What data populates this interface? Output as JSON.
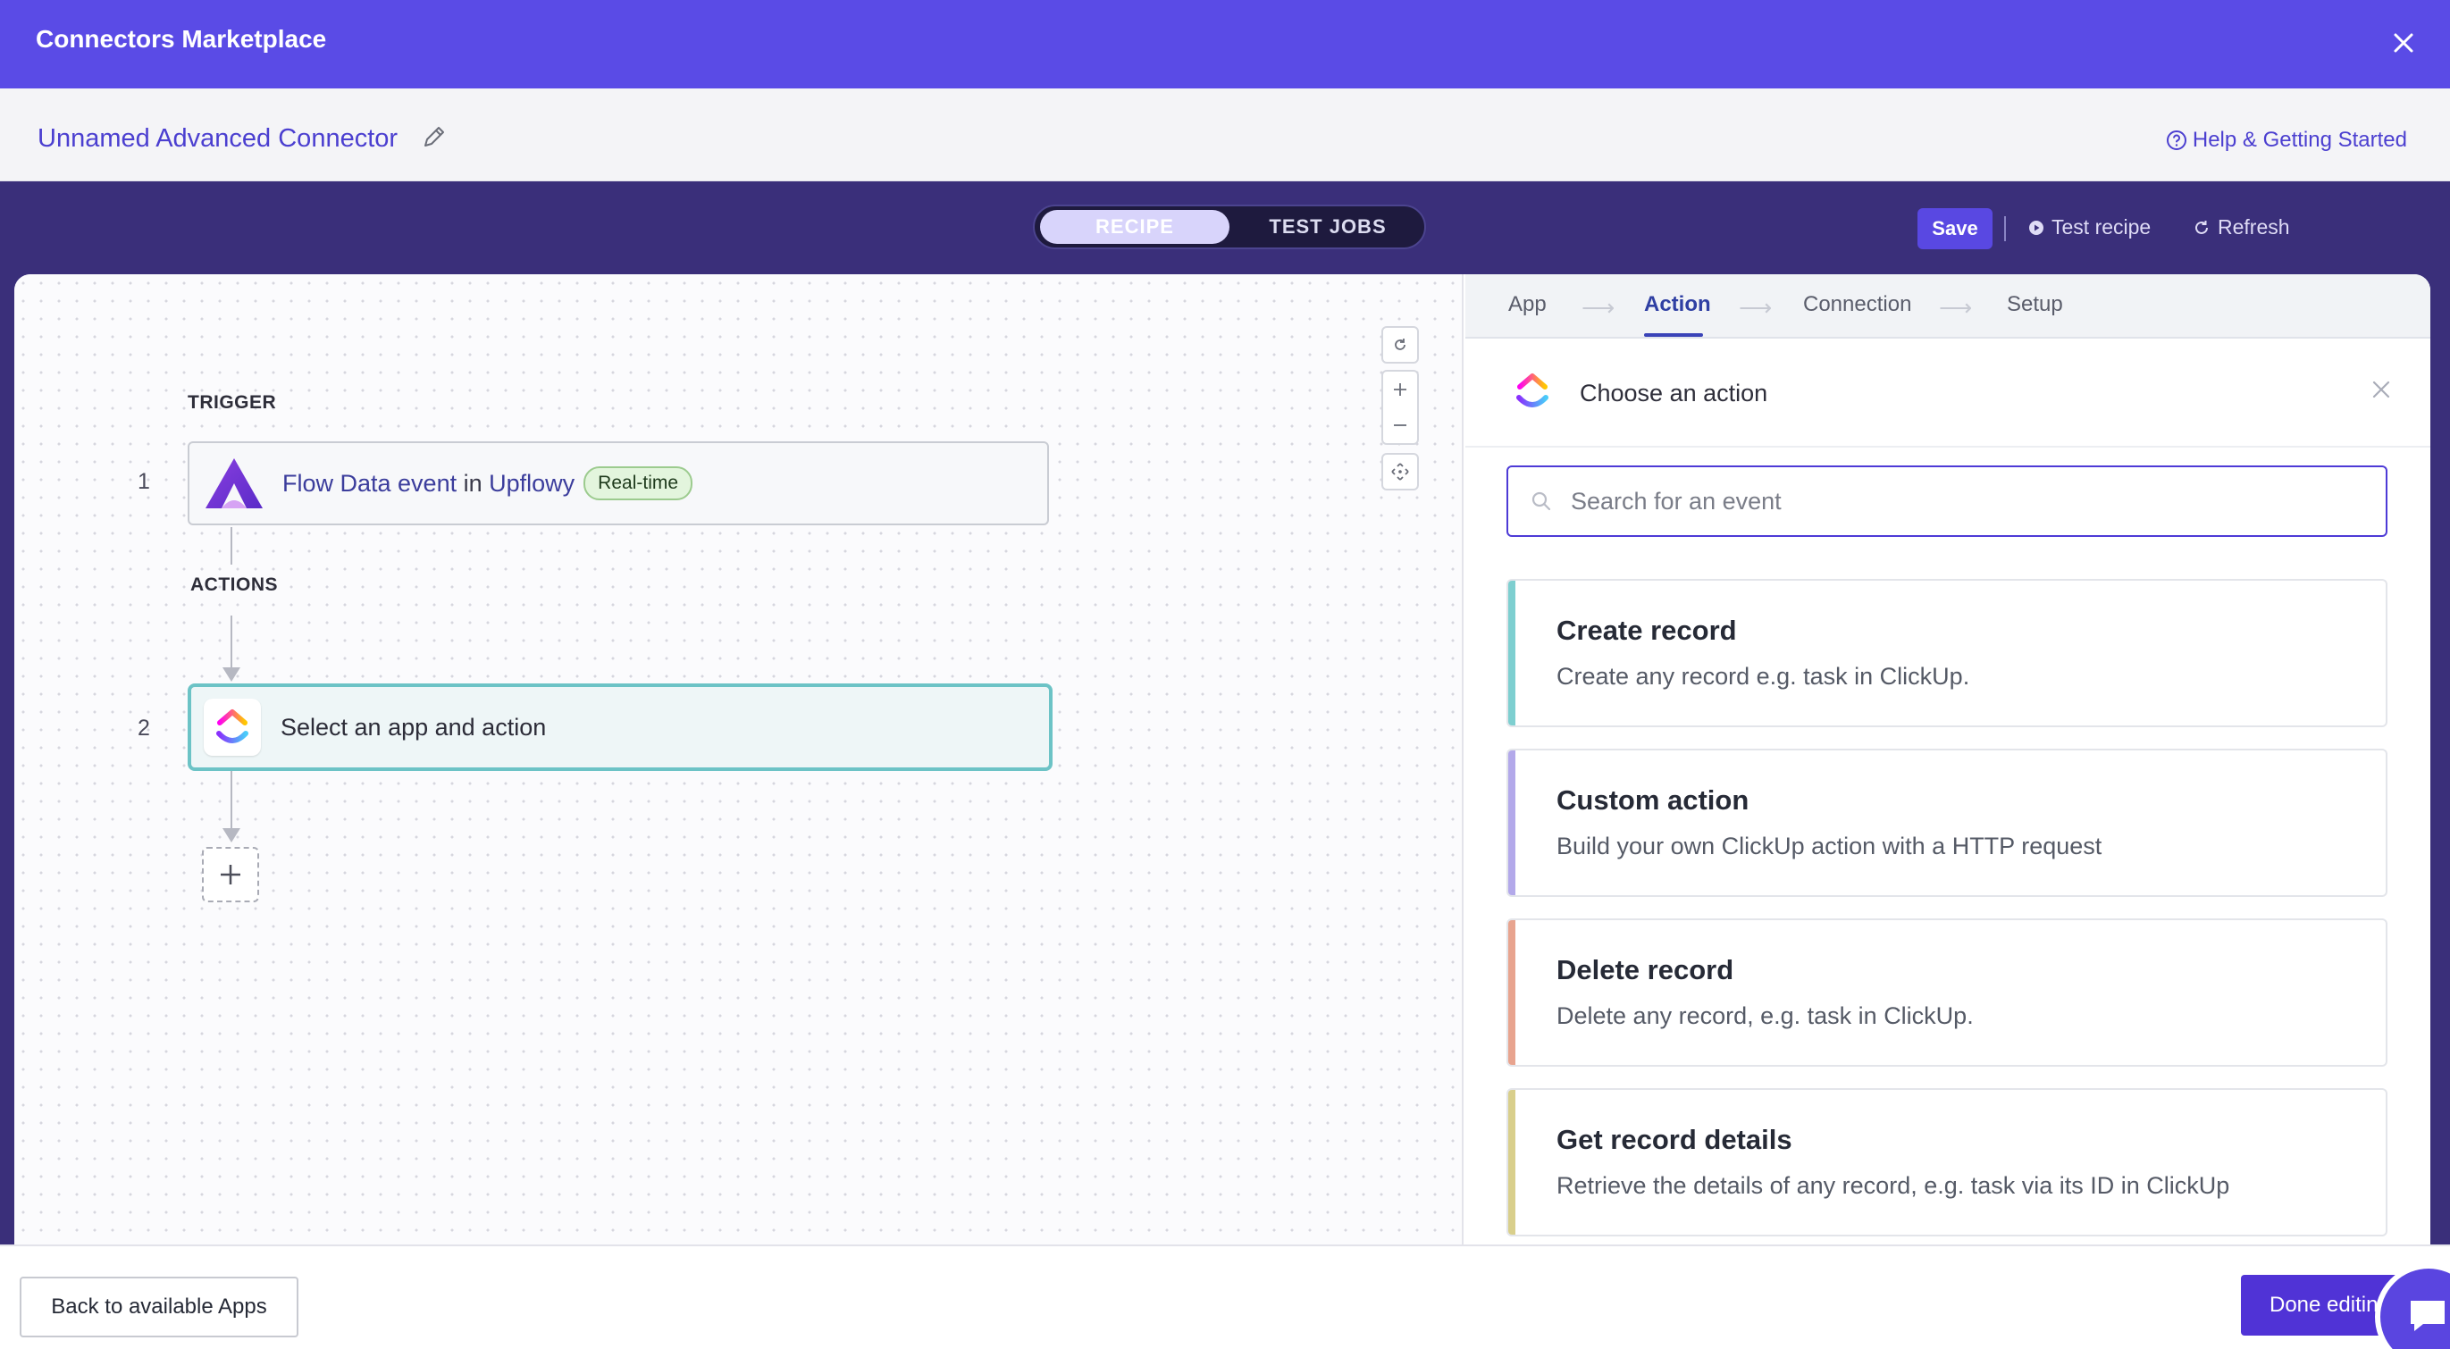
{
  "modal": {
    "title": "Connectors Marketplace"
  },
  "header": {
    "connector_name": "Unnamed Advanced Connector",
    "help_label": "Help & Getting Started"
  },
  "toolbar": {
    "tabs": [
      {
        "label": "RECIPE",
        "active": true
      },
      {
        "label": "TEST JOBS",
        "active": false
      }
    ],
    "save_label": "Save",
    "test_recipe_label": "Test recipe",
    "refresh_label": "Refresh"
  },
  "recipe": {
    "trigger_label": "TRIGGER",
    "actions_label": "ACTIONS",
    "steps": [
      {
        "number": "1",
        "event": "Flow Data event",
        "connector_word": "in",
        "app": "Upflowy",
        "badge": "Real-time"
      },
      {
        "number": "2",
        "text": "Select an app and action"
      }
    ]
  },
  "wizard": {
    "steps": [
      {
        "label": "App",
        "active": false
      },
      {
        "label": "Action",
        "active": true
      },
      {
        "label": "Connection",
        "active": false
      },
      {
        "label": "Setup",
        "active": false
      }
    ],
    "heading": "Choose an action",
    "search_placeholder": "Search for an event",
    "actions": [
      {
        "title": "Create record",
        "description": "Create any record e.g. task in ClickUp.",
        "accent": "#7ecfd0"
      },
      {
        "title": "Custom action",
        "description": "Build your own ClickUp action with a HTTP request",
        "accent": "#b3a9ea"
      },
      {
        "title": "Delete record",
        "description": "Delete any record, e.g. task in ClickUp.",
        "accent": "#e8a48f"
      },
      {
        "title": "Get record details",
        "description": "Retrieve the details of any record, e.g. task via its ID in ClickUp",
        "accent": "#d9cf8c"
      }
    ]
  },
  "footer": {
    "back_label": "Back to available Apps",
    "done_label": "Done editing"
  },
  "colors": {
    "brand": "#5a4be6",
    "stage": "#3a2f7a",
    "accent_teal": "#6cc3c6"
  }
}
